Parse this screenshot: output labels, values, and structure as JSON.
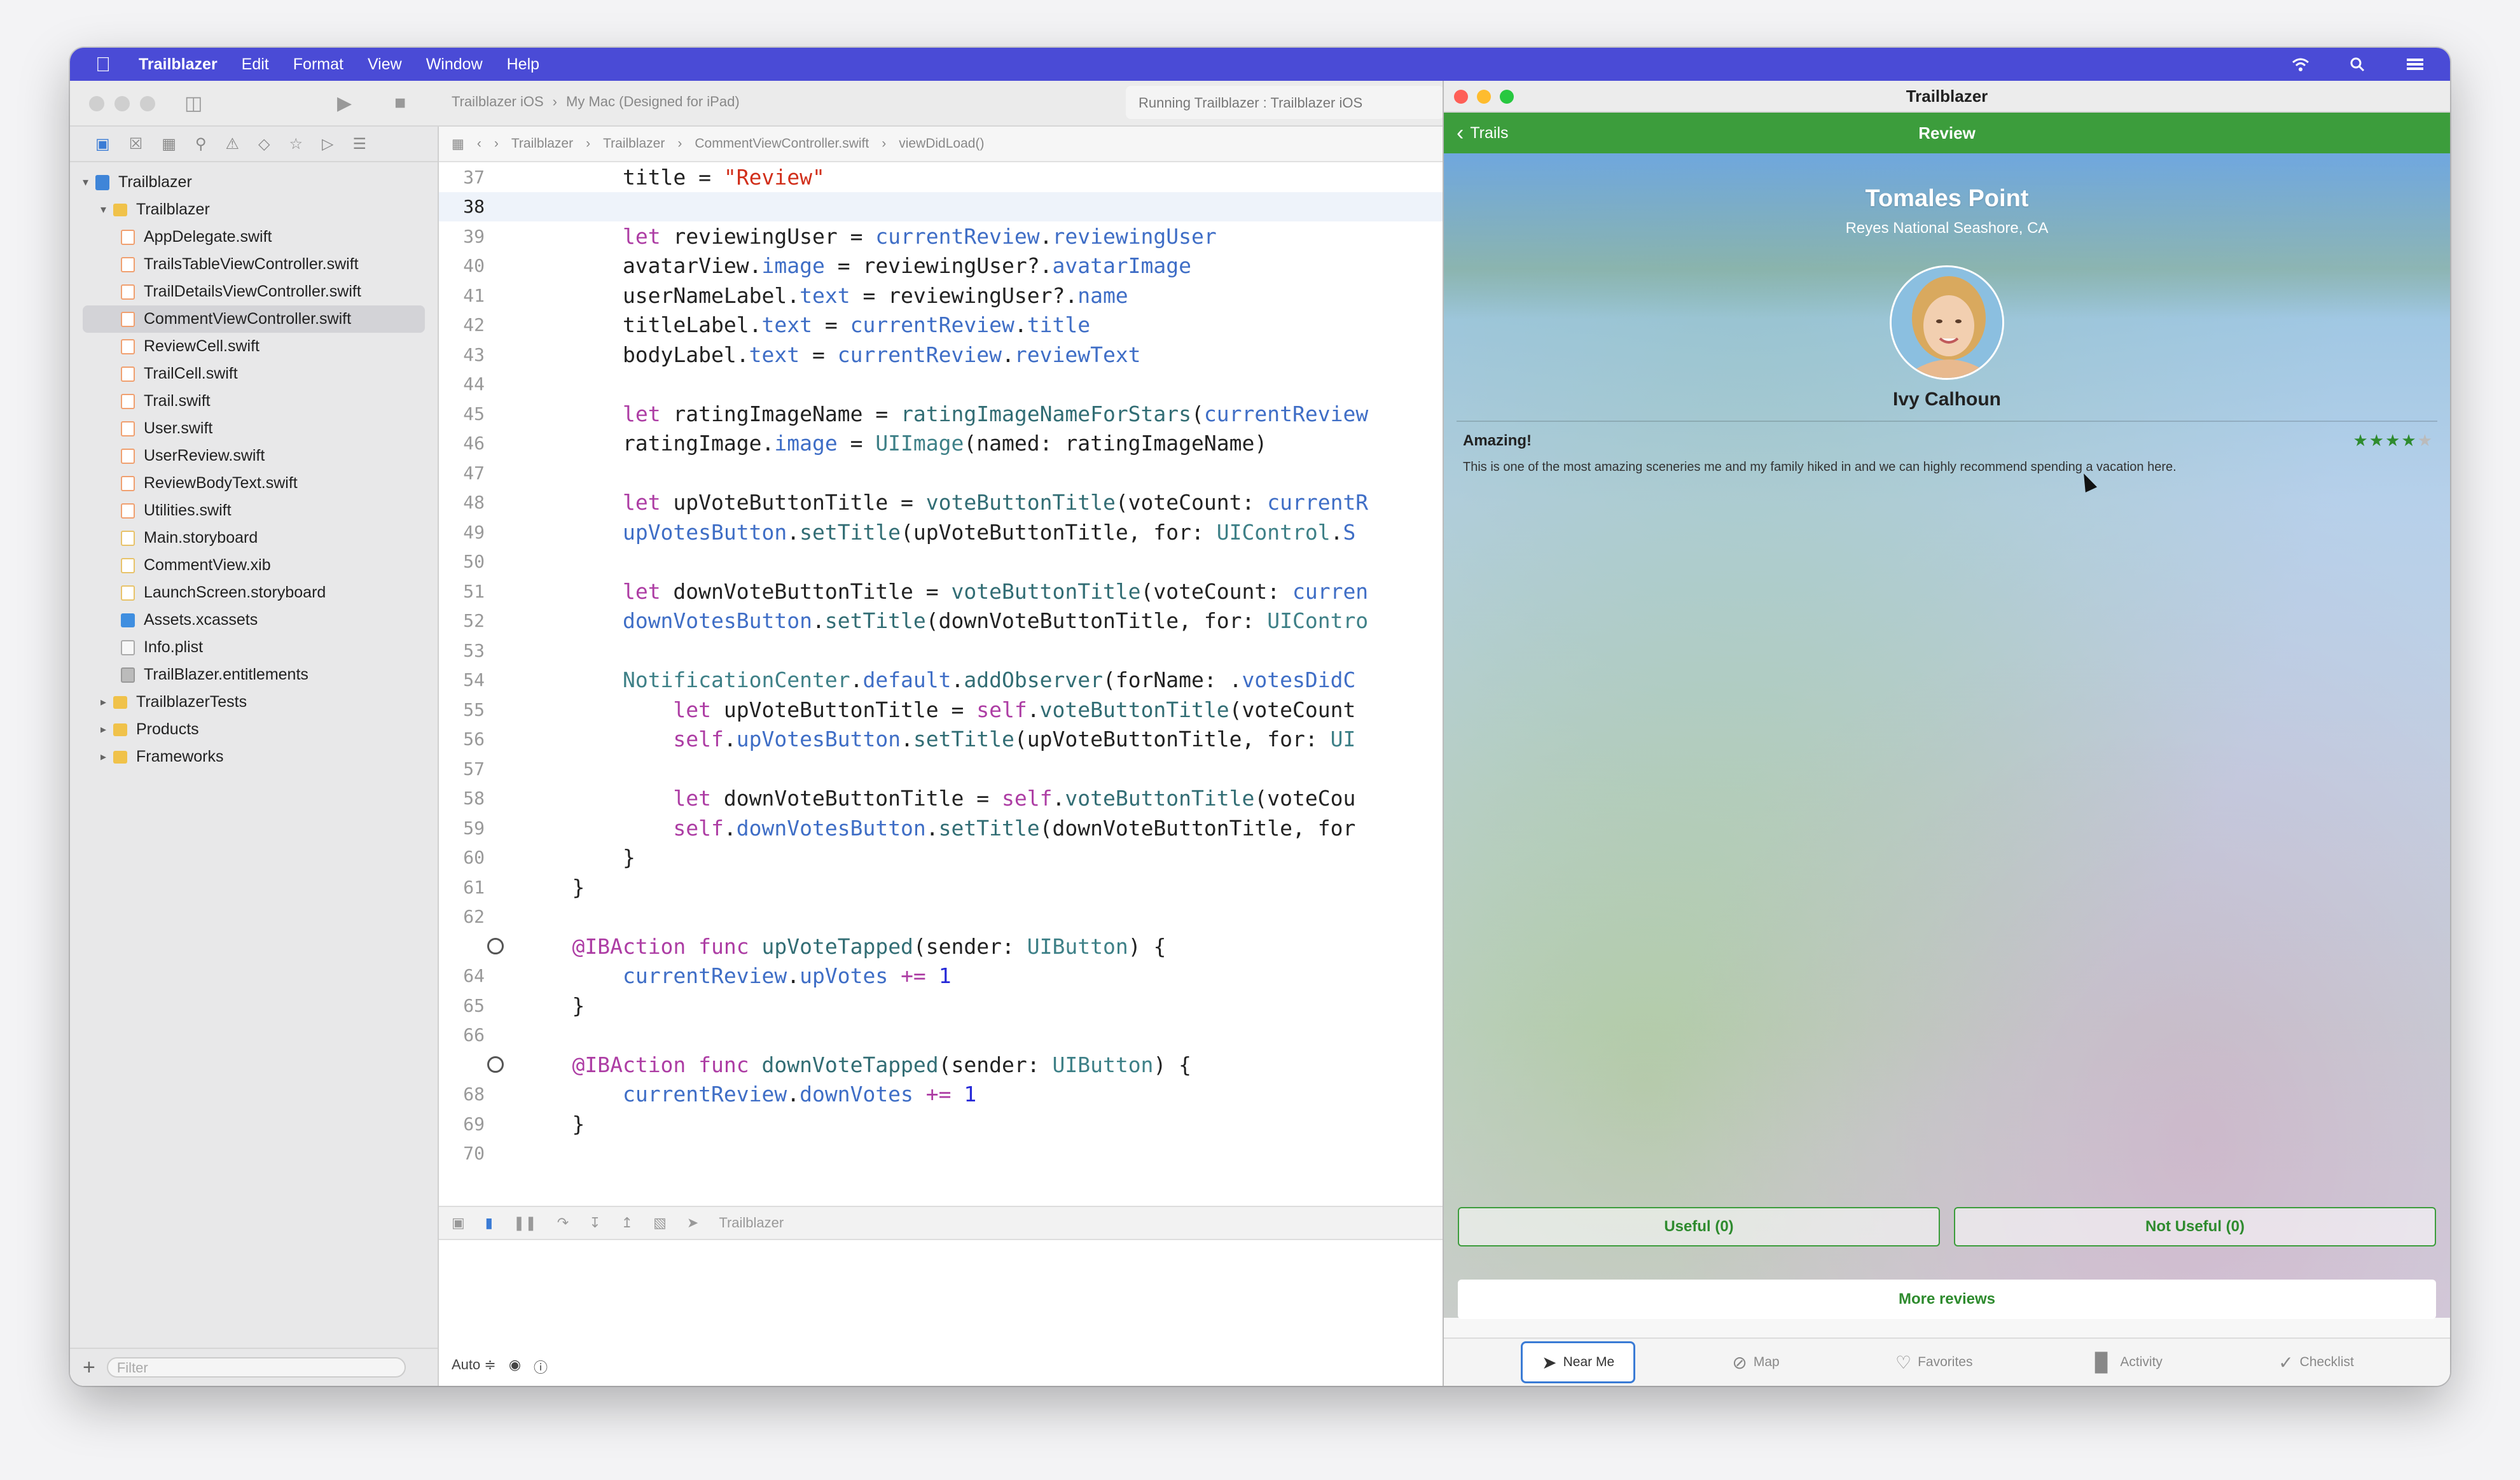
{
  "menubar": {
    "app_name": "Trailblazer",
    "items": [
      "Edit",
      "Format",
      "View",
      "Window",
      "Help"
    ]
  },
  "xcode": {
    "scheme": "Trailblazer iOS",
    "destination": "My Mac (Designed for iPad)",
    "status": "Running Trailblazer : Trailblazer iOS",
    "breadcrumb": [
      "Trailblazer",
      "Trailblazer",
      "CommentViewController.swift",
      "viewDidLoad()"
    ],
    "navigator": {
      "project": "Trailblazer",
      "group": "Trailblazer",
      "files": [
        {
          "name": "AppDelegate.swift",
          "kind": "swift"
        },
        {
          "name": "TrailsTableViewController.swift",
          "kind": "swift"
        },
        {
          "name": "TrailDetailsViewController.swift",
          "kind": "swift"
        },
        {
          "name": "CommentViewController.swift",
          "kind": "swift",
          "selected": true
        },
        {
          "name": "ReviewCell.swift",
          "kind": "swift"
        },
        {
          "name": "TrailCell.swift",
          "kind": "swift"
        },
        {
          "name": "Trail.swift",
          "kind": "swift"
        },
        {
          "name": "User.swift",
          "kind": "swift"
        },
        {
          "name": "UserReview.swift",
          "kind": "swift"
        },
        {
          "name": "ReviewBodyText.swift",
          "kind": "swift"
        },
        {
          "name": "Utilities.swift",
          "kind": "swift"
        },
        {
          "name": "Main.storyboard",
          "kind": "xib"
        },
        {
          "name": "CommentView.xib",
          "kind": "xib"
        },
        {
          "name": "LaunchScreen.storyboard",
          "kind": "xib"
        },
        {
          "name": "Assets.xcassets",
          "kind": "assets"
        },
        {
          "name": "Info.plist",
          "kind": "plist"
        },
        {
          "name": "TrailBlazer.entitlements",
          "kind": "ent"
        }
      ],
      "groups": [
        "TrailblazerTests",
        "Products",
        "Frameworks"
      ],
      "filter_placeholder": "Filter"
    },
    "debug_target": "Trailblazer",
    "console_mode": "Auto ≑"
  },
  "code": [
    {
      "n": "37",
      "html": "        title = <span class=\"str\">\"Review\"</span>"
    },
    {
      "n": "38",
      "html": "",
      "current": true
    },
    {
      "n": "39",
      "html": "        <span class=\"kw\">let</span> reviewingUser = <span class=\"pr\">currentReview</span>.<span class=\"pr\">reviewingUser</span>"
    },
    {
      "n": "40",
      "html": "        avatarView.<span class=\"pr\">image</span> = reviewingUser?.<span class=\"pr\">avatarImage</span>"
    },
    {
      "n": "41",
      "html": "        userNameLabel.<span class=\"pr\">text</span> = reviewingUser?.<span class=\"pr\">name</span>"
    },
    {
      "n": "42",
      "html": "        titleLabel.<span class=\"pr\">text</span> = <span class=\"pr\">currentReview</span>.<span class=\"pr\">title</span>"
    },
    {
      "n": "43",
      "html": "        bodyLabel.<span class=\"pr\">text</span> = <span class=\"pr\">currentReview</span>.<span class=\"pr\">reviewText</span>"
    },
    {
      "n": "44",
      "html": ""
    },
    {
      "n": "45",
      "html": "        <span class=\"kw\">let</span> ratingImageName = <span class=\"fn\">ratingImageNameForStars</span>(<span class=\"pr\">currentReview</span>"
    },
    {
      "n": "46",
      "html": "        ratingImage.<span class=\"pr\">image</span> = <span class=\"ty\">UIImage</span>(named: ratingImageName)"
    },
    {
      "n": "47",
      "html": ""
    },
    {
      "n": "48",
      "html": "        <span class=\"kw\">let</span> upVoteButtonTitle = <span class=\"fn\">voteButtonTitle</span>(voteCount: <span class=\"pr\">currentR</span>"
    },
    {
      "n": "49",
      "html": "        <span class=\"pr\">upVotesButton</span>.<span class=\"fn\">setTitle</span>(upVoteButtonTitle, for: <span class=\"ty\">UIControl</span>.<span class=\"pr\">S</span>"
    },
    {
      "n": "50",
      "html": ""
    },
    {
      "n": "51",
      "html": "        <span class=\"kw\">let</span> downVoteButtonTitle = <span class=\"fn\">voteButtonTitle</span>(voteCount: <span class=\"pr\">curren</span>"
    },
    {
      "n": "52",
      "html": "        <span class=\"pr\">downVotesButton</span>.<span class=\"fn\">setTitle</span>(downVoteButtonTitle, for: <span class=\"ty\">UIContro</span>"
    },
    {
      "n": "53",
      "html": ""
    },
    {
      "n": "54",
      "html": "        <span class=\"ty\">NotificationCenter</span>.<span class=\"pr\">default</span>.<span class=\"fn\">addObserver</span>(forName: .<span class=\"pr\">votesDidC</span>"
    },
    {
      "n": "55",
      "html": "            <span class=\"kw\">let</span> upVoteButtonTitle = <span class=\"kw\">self</span>.<span class=\"fn\">voteButtonTitle</span>(voteCount"
    },
    {
      "n": "56",
      "html": "            <span class=\"kw\">self</span>.<span class=\"pr\">upVotesButton</span>.<span class=\"fn\">setTitle</span>(upVoteButtonTitle, for: <span class=\"ty\">UI</span>"
    },
    {
      "n": "57",
      "html": ""
    },
    {
      "n": "58",
      "html": "            <span class=\"kw\">let</span> downVoteButtonTitle = <span class=\"kw\">self</span>.<span class=\"fn\">voteButtonTitle</span>(voteCou"
    },
    {
      "n": "59",
      "html": "            <span class=\"kw\">self</span>.<span class=\"pr\">downVotesButton</span>.<span class=\"fn\">setTitle</span>(downVoteButtonTitle, for"
    },
    {
      "n": "60",
      "html": "        }"
    },
    {
      "n": "61",
      "html": "    }"
    },
    {
      "n": "62",
      "html": ""
    },
    {
      "n": "63",
      "html": "    <span class=\"kw\">@IBAction func</span> <span class=\"fn\">upVoteTapped</span>(sender: <span class=\"ty\">UIButton</span>) {",
      "bp": true
    },
    {
      "n": "64",
      "html": "        <span class=\"pr\">currentReview</span>.<span class=\"pr\">upVotes</span> <span class=\"kw\">+=</span> <span class=\"num\">1</span>"
    },
    {
      "n": "65",
      "html": "    }"
    },
    {
      "n": "66",
      "html": ""
    },
    {
      "n": "67",
      "html": "    <span class=\"kw\">@IBAction func</span> <span class=\"fn\">downVoteTapped</span>(sender: <span class=\"ty\">UIButton</span>) {",
      "bp": true
    },
    {
      "n": "68",
      "html": "        <span class=\"pr\">currentReview</span>.<span class=\"pr\">downVotes</span> <span class=\"kw\">+=</span> <span class=\"num\">1</span>"
    },
    {
      "n": "69",
      "html": "    }"
    },
    {
      "n": "70",
      "html": ""
    }
  ],
  "sim": {
    "window_title": "Trailblazer",
    "back_label": "Trails",
    "nav_title": "Review",
    "trail_name": "Tomales Point",
    "trail_location": "Reyes National Seashore, CA",
    "user_name": "Ivy Calhoun",
    "review_title": "Amazing!",
    "rating": 4,
    "rating_max": 5,
    "review_body": "This is one of the most amazing sceneries me and my family hiked in and we can highly recommend spending a vacation here.",
    "useful_label": "Useful (0)",
    "not_useful_label": "Not Useful (0)",
    "more_reviews_label": "More reviews",
    "tabs": [
      {
        "label": "Near Me",
        "icon": "location-arrow-icon",
        "active": true
      },
      {
        "label": "Map",
        "icon": "compass-icon"
      },
      {
        "label": "Favorites",
        "icon": "heart-icon"
      },
      {
        "label": "Activity",
        "icon": "bar-chart-icon"
      },
      {
        "label": "Checklist",
        "icon": "checkmark-icon"
      }
    ]
  },
  "colors": {
    "accent_green": "#3c9d3c",
    "menubar": "#4a4bd6",
    "selection_blue": "#3a7bd5"
  }
}
